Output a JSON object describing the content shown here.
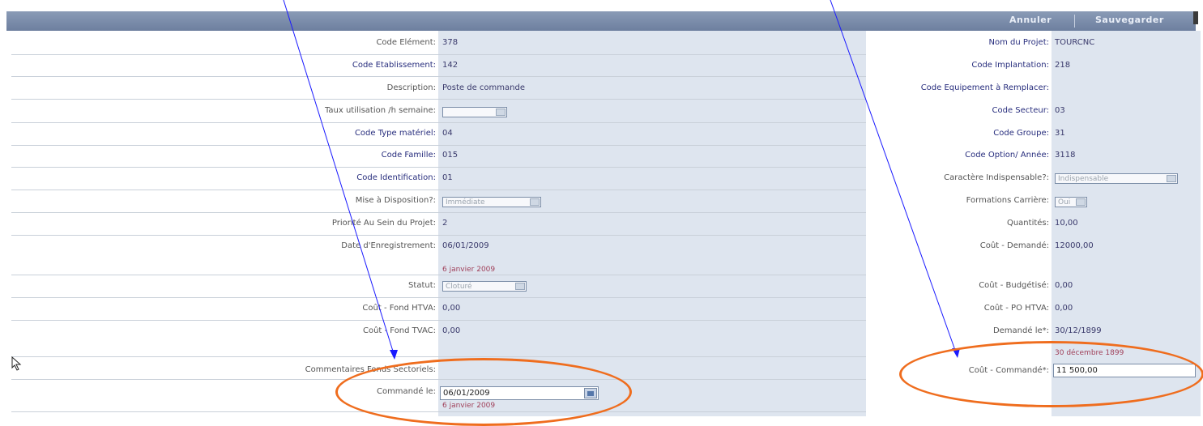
{
  "toolbar": {
    "cancel_label": "Annuler",
    "save_label": "Sauvegarder"
  },
  "left": {
    "code_element": {
      "label": "Code Elément:",
      "value": "378"
    },
    "code_etablissement": {
      "label": "Code Etablissement:",
      "value": "142"
    },
    "description": {
      "label": "Description:",
      "value": "Poste de commande"
    },
    "taux_utilisation": {
      "label": "Taux utilisation /h semaine:",
      "value": ""
    },
    "code_type_materiel": {
      "label": "Code Type matériel:",
      "value": "04"
    },
    "code_famille": {
      "label": "Code Famille:",
      "value": "015"
    },
    "code_identification": {
      "label": "Code Identification:",
      "value": "01"
    },
    "mise_a_disposition": {
      "label": "Mise à Disposition?:",
      "value": "Immédiate"
    },
    "priorite": {
      "label": "Priorité Au Sein du Projet:",
      "value": "2"
    },
    "date_enregistrement": {
      "label": "Date d'Enregistrement:",
      "value": "06/01/2009",
      "long": "6 janvier 2009"
    },
    "statut": {
      "label": "Statut:",
      "value": "Cloturé"
    },
    "cout_fond_htva": {
      "label": "Coût - Fond HTVA:",
      "value": "0,00"
    },
    "cout_fond_tvac": {
      "label": "Coût - Fond TVAC:",
      "value": "0,00"
    },
    "commentaires": {
      "label": "Commentaires Fonds Sectoriels:"
    },
    "commande_le": {
      "label": "Commandé le:",
      "value": "06/01/2009",
      "long": "6 janvier 2009"
    }
  },
  "right": {
    "nom_projet": {
      "label": "Nom du Projet:",
      "value": "TOURCNC"
    },
    "code_implantation": {
      "label": "Code Implantation:",
      "value": "218"
    },
    "code_equipement": {
      "label": "Code Equipement à Remplacer:",
      "value": ""
    },
    "code_secteur": {
      "label": "Code Secteur:",
      "value": "03"
    },
    "code_groupe": {
      "label": "Code Groupe:",
      "value": "31"
    },
    "code_option": {
      "label": "Code Option/ Année:",
      "value": "3118"
    },
    "caractere_indispensable": {
      "label": "Caractère Indispensable?:",
      "value": "Indispensable"
    },
    "formations_carriere": {
      "label": "Formations Carrière:",
      "value": "Oui"
    },
    "quantites": {
      "label": "Quantités:",
      "value": "10,00"
    },
    "cout_demande": {
      "label": "Coût - Demandé:",
      "value": "12000,00"
    },
    "cout_budgetise": {
      "label": "Coût - Budgétisé:",
      "value": "0,00"
    },
    "cout_po_htva": {
      "label": "Coût - PO HTVA:",
      "value": "0,00"
    },
    "demande_le": {
      "label": "Demandé le*:",
      "value": "30/12/1899",
      "long": "30 décembre 1899"
    },
    "cout_commande": {
      "label": "Coût - Commandé*:",
      "value": "11 500,00"
    }
  },
  "annotations": {
    "highlight_color": "#ef6d1e",
    "arrow_color": "#1a1aff"
  }
}
